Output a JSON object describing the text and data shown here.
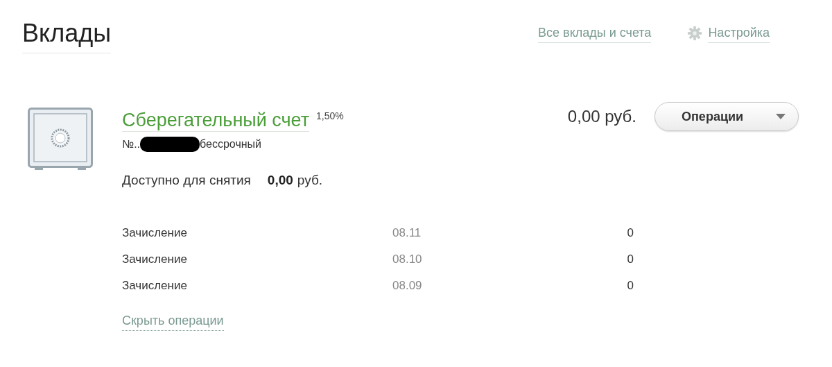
{
  "title": "Вклады",
  "header_links": [
    {
      "kind": "link",
      "label": "Все вклады и счета"
    },
    {
      "kind": "settings",
      "label": "Настройка"
    }
  ],
  "account": {
    "name": "Сберегательный счет",
    "rate": "1,50%",
    "number_prefix": "№..",
    "term": "бессрочный",
    "balance": "0,00 руб.",
    "operations_button": "Операции",
    "available_label": "Доступно для снятия",
    "available_amount": "0,00",
    "available_currency": "руб.",
    "operations": [
      {
        "type": "Зачисление",
        "date": "08.11",
        "amount": "0"
      },
      {
        "type": "Зачисление",
        "date": "08.10",
        "amount": "0"
      },
      {
        "type": "Зачисление",
        "date": "08.09",
        "amount": "0"
      }
    ],
    "hide_link": "Скрыть операции"
  }
}
